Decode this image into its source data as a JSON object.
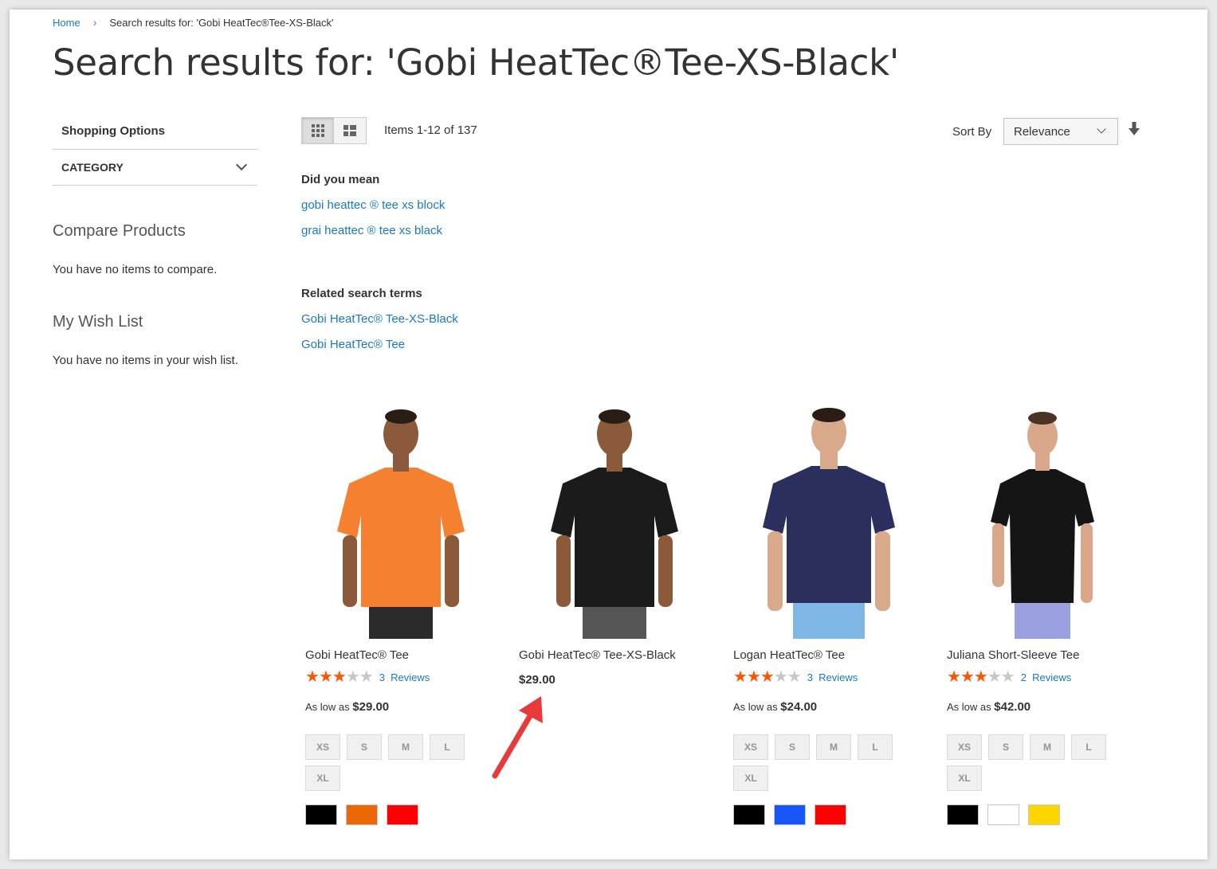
{
  "breadcrumb": {
    "home": "Home",
    "separator": "›",
    "current": "Search results for: 'Gobi HeatTec®Tee-XS-Black'"
  },
  "page_title": "Search results for: 'Gobi HeatTec®Tee-XS-Black'",
  "sidebar": {
    "shopping_options": "Shopping Options",
    "category": "CATEGORY",
    "compare_title": "Compare Products",
    "compare_text": "You have no items to compare.",
    "wishlist_title": "My Wish List",
    "wishlist_text": "You have no items in your wish list."
  },
  "toolbar": {
    "items_count": "Items 1-12 of 137",
    "sort_label": "Sort By",
    "sort_value": "Relevance"
  },
  "did_you_mean": {
    "heading": "Did you mean",
    "links": [
      "gobi heattec ® tee xs block",
      "grai heattec ® tee xs black"
    ]
  },
  "related": {
    "heading": "Related search terms",
    "links": [
      "Gobi HeatTec® Tee-XS-Black",
      "Gobi HeatTec® Tee"
    ]
  },
  "products": [
    {
      "name": "Gobi HeatTec® Tee",
      "rating_stars": 3,
      "review_count": "3",
      "reviews_label": "Reviews",
      "price_prefix": "As low as",
      "price": "$29.00",
      "sizes": [
        "XS",
        "S",
        "M",
        "L",
        "XL"
      ],
      "colors": [
        "#000000",
        "#eb6703",
        "#ff0000"
      ],
      "shirt_color": "#f5802f"
    },
    {
      "name": "Gobi HeatTec® Tee-XS-Black",
      "price": "$29.00",
      "shirt_color": "#1b1b1b"
    },
    {
      "name": "Logan HeatTec® Tee",
      "rating_stars": 3,
      "review_count": "3",
      "reviews_label": "Reviews",
      "price_prefix": "As low as",
      "price": "$24.00",
      "sizes": [
        "XS",
        "S",
        "M",
        "L",
        "XL"
      ],
      "colors": [
        "#000000",
        "#1857f7",
        "#ff0000"
      ],
      "shirt_color": "#2a2f5e"
    },
    {
      "name": "Juliana Short-Sleeve Tee",
      "rating_stars": 3,
      "review_count": "2",
      "reviews_label": "Reviews",
      "price_prefix": "As low as",
      "price": "$42.00",
      "sizes": [
        "XS",
        "S",
        "M",
        "L",
        "XL"
      ],
      "colors": [
        "#000000",
        "#ffffff",
        "#ffd500"
      ],
      "shirt_color": "#151515"
    }
  ],
  "colors": {
    "link": "#1979c3",
    "star": "#ff5501",
    "arrow": "#e8393b"
  }
}
